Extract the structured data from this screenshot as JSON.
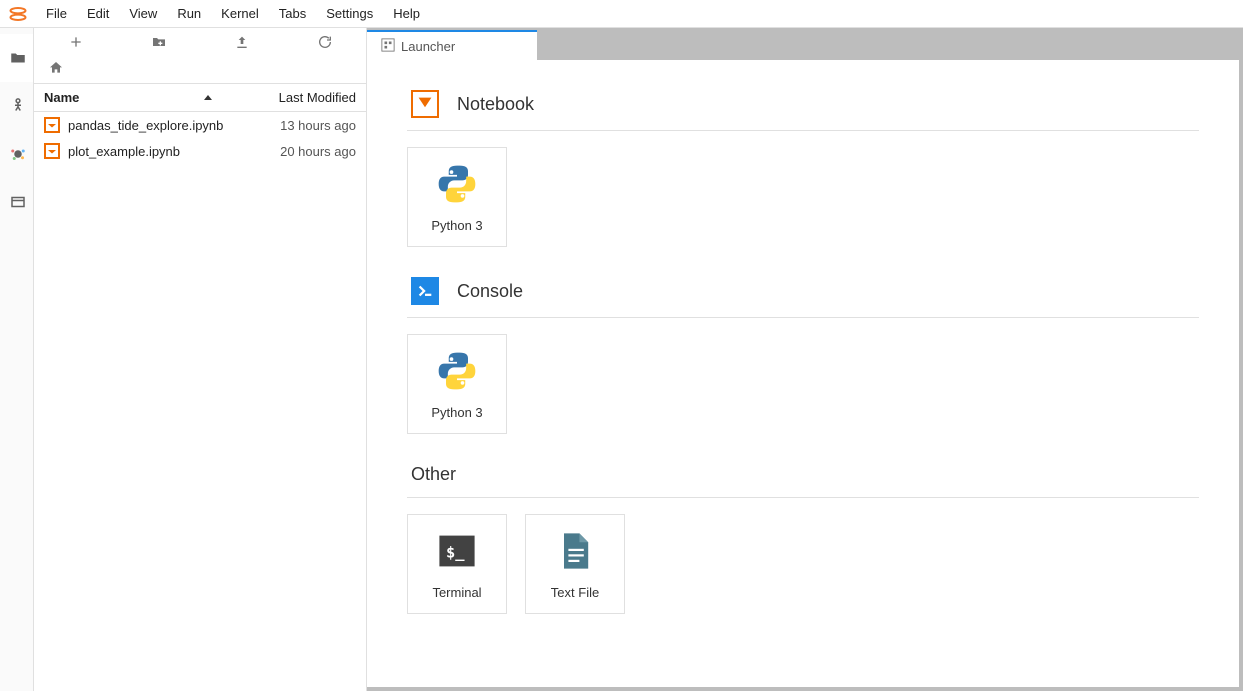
{
  "menus": {
    "file": "File",
    "edit": "Edit",
    "view": "View",
    "run": "Run",
    "kernel": "Kernel",
    "tabs": "Tabs",
    "settings": "Settings",
    "help": "Help"
  },
  "filebrowser": {
    "header_name": "Name",
    "header_modified": "Last Modified",
    "files": [
      {
        "name": "pandas_tide_explore.ipynb",
        "modified": "13 hours ago"
      },
      {
        "name": "plot_example.ipynb",
        "modified": "20 hours ago"
      }
    ]
  },
  "tab": {
    "label": "Launcher"
  },
  "launcher": {
    "notebook": {
      "title": "Notebook",
      "card": "Python 3"
    },
    "console": {
      "title": "Console",
      "card": "Python 3"
    },
    "other": {
      "title": "Other",
      "terminal": "Terminal",
      "textfile": "Text File"
    }
  }
}
